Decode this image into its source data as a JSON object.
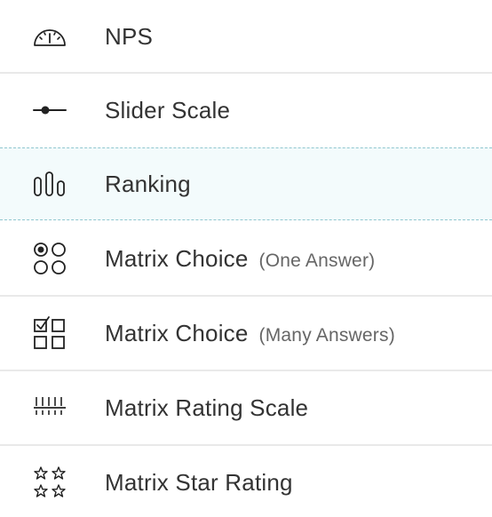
{
  "items": [
    {
      "label": "NPS",
      "sub": "",
      "icon": "gauge-icon"
    },
    {
      "label": "Slider Scale",
      "sub": "",
      "icon": "slider-icon"
    },
    {
      "label": "Ranking",
      "sub": "",
      "icon": "ranking-bars-icon",
      "selected": true
    },
    {
      "label": "Matrix Choice",
      "sub": "(One Answer)",
      "icon": "radio-grid-icon"
    },
    {
      "label": "Matrix Choice",
      "sub": "(Many Answers)",
      "icon": "checkbox-grid-icon"
    },
    {
      "label": "Matrix Rating Scale",
      "sub": "",
      "icon": "rating-scale-icon"
    },
    {
      "label": "Matrix Star Rating",
      "sub": "",
      "icon": "stars-grid-icon"
    }
  ],
  "colors": {
    "selected_background": "#f3fbfc",
    "selected_border": "#8fc6cf",
    "divider": "#e9e9e9",
    "text": "#333333",
    "subtext": "#666666"
  }
}
